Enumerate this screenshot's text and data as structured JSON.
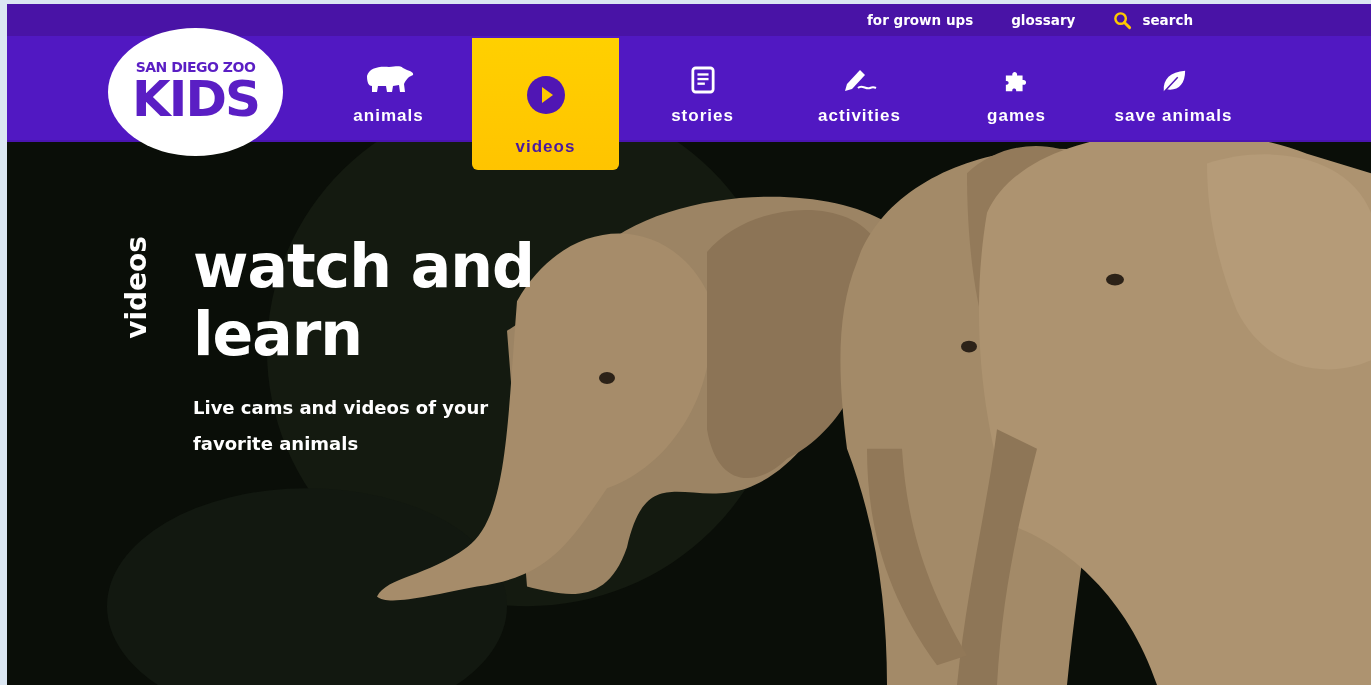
{
  "utility_links": [
    {
      "label": "for grown ups"
    },
    {
      "label": "glossary"
    }
  ],
  "search": {
    "label": "search"
  },
  "logo": {
    "line_1": "SAN DIEGO ZOO",
    "line_2": "KIDS"
  },
  "nav": [
    {
      "label": "animals",
      "kind": "bear",
      "selected": false
    },
    {
      "label": "videos",
      "kind": "play",
      "selected": true
    },
    {
      "label": "stories",
      "kind": "document",
      "selected": false
    },
    {
      "label": "activities",
      "kind": "pencil",
      "selected": false
    },
    {
      "label": "games",
      "kind": "puzzle",
      "selected": false
    },
    {
      "label": "save animals",
      "kind": "leaf",
      "selected": false
    }
  ],
  "hero": {
    "section_label": "videos",
    "title": "watch and learn",
    "subtitle": "Live cams and videos of your favorite animals"
  }
}
